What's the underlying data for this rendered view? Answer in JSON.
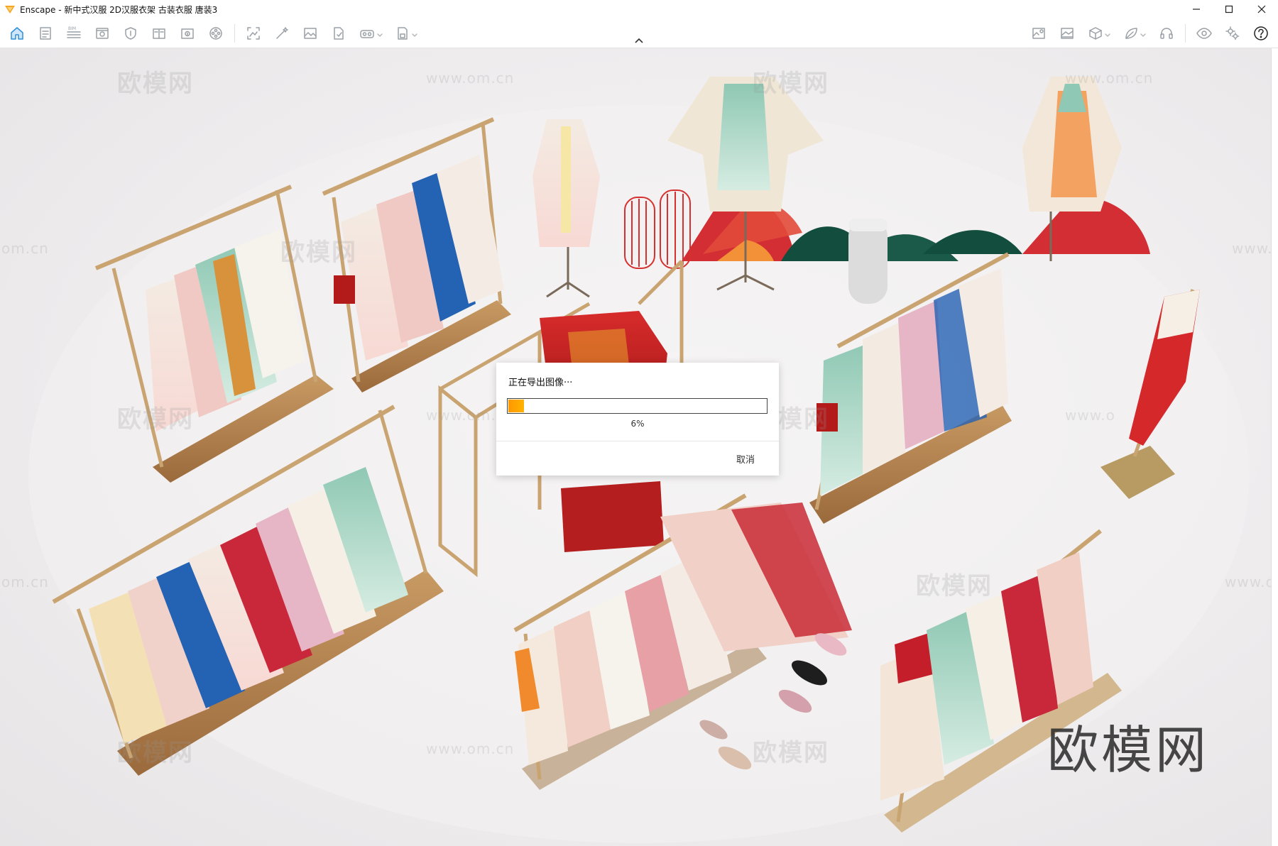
{
  "window": {
    "title": "Enscape - 新中式汉服 2D汉服衣架 古装衣服 唐装3"
  },
  "toolbar": {
    "left_icons": [
      "home-icon",
      "document-icon",
      "bim-icon",
      "view-icon",
      "shield-icon",
      "book-icon",
      "info-book-icon",
      "film-icon",
      "capture-icon",
      "magic-wand-icon",
      "image-icon",
      "file-export-icon",
      "vr-icon",
      "save-icon"
    ],
    "right_icons": [
      "map-icon",
      "landscape-icon",
      "cube-icon",
      "leaf-icon",
      "headset-icon",
      "eye-icon",
      "settings-icon",
      "help-icon"
    ]
  },
  "dialog": {
    "title": "正在导出图像···",
    "percent_label": "6%",
    "progress": 0.06,
    "cancel_label": "取消"
  },
  "watermarks": {
    "brand": "欧模网",
    "url": "www.om.cn",
    "url_short": "om.cn",
    "url_prefix": "www.o"
  }
}
